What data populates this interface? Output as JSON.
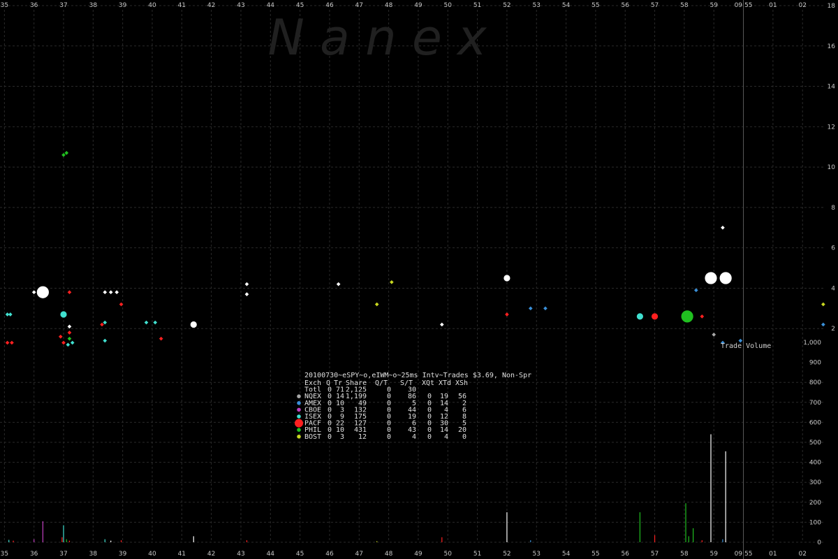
{
  "watermark": "N  a  n  e  x",
  "header": "20100730~eSPY~o,eIWM~o~25ms Intv~Trades $3.69, Non-Spr",
  "volume_label": "Trade Volume",
  "table": {
    "columns": [
      "Exch",
      "Q",
      "Tr",
      "Share",
      "Q/T",
      "S/T",
      "XQt",
      "XTd",
      "XSh"
    ],
    "rows": [
      {
        "exch": "Totl",
        "q": "0",
        "tr": "71",
        "share": "2,125",
        "qt": "0",
        "st": "30",
        "xqt": "",
        "xtd": "",
        "xsh": "",
        "color": ""
      },
      {
        "exch": "NQEX",
        "q": "0",
        "tr": "14",
        "share": "1,199",
        "qt": "0",
        "st": "86",
        "xqt": "0",
        "xtd": "19",
        "xsh": "56",
        "color": "#a8a8a8"
      },
      {
        "exch": "AMEX",
        "q": "0",
        "tr": "10",
        "share": "49",
        "qt": "0",
        "st": "5",
        "xqt": "0",
        "xtd": "14",
        "xsh": "2",
        "color": "#3a8fd8"
      },
      {
        "exch": "CBOE",
        "q": "0",
        "tr": "3",
        "share": "132",
        "qt": "0",
        "st": "44",
        "xqt": "0",
        "xtd": "4",
        "xsh": "6",
        "color": "#c040c0"
      },
      {
        "exch": "ISEX",
        "q": "0",
        "tr": "9",
        "share": "175",
        "qt": "0",
        "st": "19",
        "xqt": "0",
        "xtd": "12",
        "xsh": "8",
        "color": "#40e0d0"
      },
      {
        "exch": "PACF",
        "q": "0",
        "tr": "22",
        "share": "127",
        "qt": "0",
        "st": "6",
        "xqt": "0",
        "xtd": "30",
        "xsh": "5",
        "color": "#ff2020"
      },
      {
        "exch": "PHIL",
        "q": "0",
        "tr": "10",
        "share": "431",
        "qt": "0",
        "st": "43",
        "xqt": "0",
        "xtd": "14",
        "xsh": "20",
        "color": "#20c020"
      },
      {
        "exch": "BOST",
        "q": "0",
        "tr": "3",
        "share": "12",
        "qt": "0",
        "st": "4",
        "xqt": "0",
        "xtd": "4",
        "xsh": "0",
        "color": "#c8d820"
      }
    ]
  },
  "chart_data": {
    "type": "scatter",
    "x_ticks_top": [
      "35",
      "36",
      "37",
      "38",
      "39",
      "40",
      "41",
      "42",
      "43",
      "44",
      "45",
      "46",
      "47",
      "48",
      "49",
      "50",
      "51",
      "52",
      "53",
      "54",
      "55",
      "56",
      "57",
      "58",
      "59",
      "09:55",
      "01",
      "02"
    ],
    "x_ticks_bottom": [
      "35",
      "36",
      "37",
      "38",
      "39",
      "40",
      "41",
      "42",
      "43",
      "44",
      "45",
      "46",
      "47",
      "48",
      "49",
      "50",
      "51",
      "52",
      "53",
      "54",
      "55",
      "56",
      "57",
      "58",
      "59",
      "09:55",
      "01",
      "02"
    ],
    "x_tick_values": [
      35,
      36,
      37,
      38,
      39,
      40,
      41,
      42,
      43,
      44,
      45,
      46,
      47,
      48,
      49,
      50,
      51,
      52,
      53,
      54,
      55,
      56,
      57,
      58,
      59,
      60,
      61,
      62
    ],
    "xlim": [
      34.85,
      63.2
    ],
    "marker_x": 60,
    "price_axis": {
      "ylim": [
        0,
        18
      ],
      "ticks": [
        "2",
        "4",
        "6",
        "8",
        "10",
        "12",
        "14",
        "16",
        "18"
      ],
      "tick_values": [
        2,
        4,
        6,
        8,
        10,
        12,
        14,
        16,
        18
      ]
    },
    "volume_axis": {
      "ylim": [
        0,
        1000
      ],
      "ticks": [
        "0",
        "100",
        "200",
        "300",
        "400",
        "500",
        "600",
        "700",
        "800",
        "900",
        "1,000"
      ],
      "tick_values": [
        0,
        100,
        200,
        300,
        400,
        500,
        600,
        700,
        800,
        900,
        1000
      ]
    },
    "series": [
      {
        "color": "#ffffff",
        "points": [
          [
            36.3,
            3.8,
            3
          ],
          [
            36.0,
            3.8,
            1
          ],
          [
            37.2,
            2.1,
            1
          ],
          [
            38.4,
            3.8,
            1
          ],
          [
            38.6,
            3.8,
            1
          ],
          [
            38.8,
            3.8,
            1
          ],
          [
            41.4,
            2.2,
            2
          ],
          [
            43.2,
            4.2,
            1
          ],
          [
            43.2,
            3.7,
            1
          ],
          [
            46.3,
            4.2,
            1
          ],
          [
            49.8,
            2.2,
            1
          ],
          [
            52.0,
            4.5,
            2
          ],
          [
            58.2,
            2.6,
            2
          ],
          [
            58.9,
            4.5,
            3
          ],
          [
            59.4,
            4.5,
            3
          ],
          [
            59.3,
            7.0,
            1
          ]
        ]
      },
      {
        "color": "#40e0d0",
        "points": [
          [
            35.1,
            2.7,
            1
          ],
          [
            35.2,
            2.7,
            1
          ],
          [
            37.0,
            2.7,
            2
          ],
          [
            37.15,
            1.2,
            1
          ],
          [
            37.3,
            1.3,
            1
          ],
          [
            38.4,
            1.4,
            1
          ],
          [
            38.4,
            2.3,
            1
          ],
          [
            39.8,
            2.3,
            1
          ],
          [
            40.1,
            2.3,
            1
          ],
          [
            56.5,
            2.6,
            2
          ]
        ]
      },
      {
        "color": "#20c020",
        "points": [
          [
            37.0,
            10.6,
            1
          ],
          [
            37.1,
            10.7,
            1
          ],
          [
            37.2,
            1.5,
            1
          ],
          [
            58.1,
            2.6,
            3
          ]
        ]
      },
      {
        "color": "#ff2020",
        "points": [
          [
            35.1,
            1.3,
            1
          ],
          [
            35.25,
            1.3,
            1
          ],
          [
            37.0,
            1.3,
            1
          ],
          [
            36.9,
            1.6,
            1
          ],
          [
            37.2,
            1.8,
            1
          ],
          [
            37.2,
            3.8,
            1
          ],
          [
            38.95,
            3.2,
            1
          ],
          [
            40.3,
            1.5,
            1
          ],
          [
            57.0,
            2.6,
            2
          ],
          [
            58.6,
            2.6,
            1
          ],
          [
            52.0,
            2.7,
            1
          ],
          [
            38.3,
            2.2,
            1
          ]
        ]
      },
      {
        "color": "#3a8fd8",
        "points": [
          [
            58.4,
            3.9,
            1
          ],
          [
            59.3,
            1.3,
            1
          ],
          [
            59.9,
            1.4,
            1
          ],
          [
            53.3,
            3.0,
            1
          ],
          [
            52.8,
            3.0,
            1
          ],
          [
            62.7,
            2.2,
            1
          ]
        ]
      },
      {
        "color": "#a8a8a8",
        "points": [
          [
            59.0,
            1.7,
            1
          ]
        ]
      },
      {
        "color": "#c8d820",
        "points": [
          [
            47.6,
            3.2,
            1
          ],
          [
            48.1,
            4.3,
            1
          ],
          [
            62.7,
            3.2,
            1
          ]
        ]
      }
    ],
    "volume_bars": [
      {
        "x": 35.15,
        "v": 12,
        "color": "#40e0d0"
      },
      {
        "x": 35.3,
        "v": 8,
        "color": "#ff2020"
      },
      {
        "x": 36.0,
        "v": 15,
        "color": "#c040c0"
      },
      {
        "x": 36.3,
        "v": 105,
        "color": "#c040c0"
      },
      {
        "x": 36.95,
        "v": 25,
        "color": "#ff2020"
      },
      {
        "x": 37.0,
        "v": 85,
        "color": "#40e0d0"
      },
      {
        "x": 37.1,
        "v": 15,
        "color": "#20c020"
      },
      {
        "x": 37.2,
        "v": 8,
        "color": "#ff2020"
      },
      {
        "x": 38.4,
        "v": 15,
        "color": "#40e0d0"
      },
      {
        "x": 38.6,
        "v": 8,
        "color": "#ffffff"
      },
      {
        "x": 38.95,
        "v": 10,
        "color": "#ff2020"
      },
      {
        "x": 41.4,
        "v": 30,
        "color": "#ffffff"
      },
      {
        "x": 43.2,
        "v": 10,
        "color": "#ff2020"
      },
      {
        "x": 47.6,
        "v": 5,
        "color": "#c8d820"
      },
      {
        "x": 49.8,
        "v": 25,
        "color": "#ff2020"
      },
      {
        "x": 52.0,
        "v": 150,
        "color": "#ffffff"
      },
      {
        "x": 52.8,
        "v": 10,
        "color": "#3a8fd8"
      },
      {
        "x": 56.5,
        "v": 150,
        "color": "#20c020"
      },
      {
        "x": 57.0,
        "v": 35,
        "color": "#ff2020"
      },
      {
        "x": 58.05,
        "v": 195,
        "color": "#20c020"
      },
      {
        "x": 58.15,
        "v": 30,
        "color": "#20c020"
      },
      {
        "x": 58.3,
        "v": 70,
        "color": "#20c020"
      },
      {
        "x": 58.6,
        "v": 10,
        "color": "#ff2020"
      },
      {
        "x": 58.9,
        "v": 540,
        "color": "#ffffff"
      },
      {
        "x": 59.3,
        "v": 15,
        "color": "#3a8fd8"
      },
      {
        "x": 59.4,
        "v": 455,
        "color": "#ffffff"
      }
    ]
  }
}
